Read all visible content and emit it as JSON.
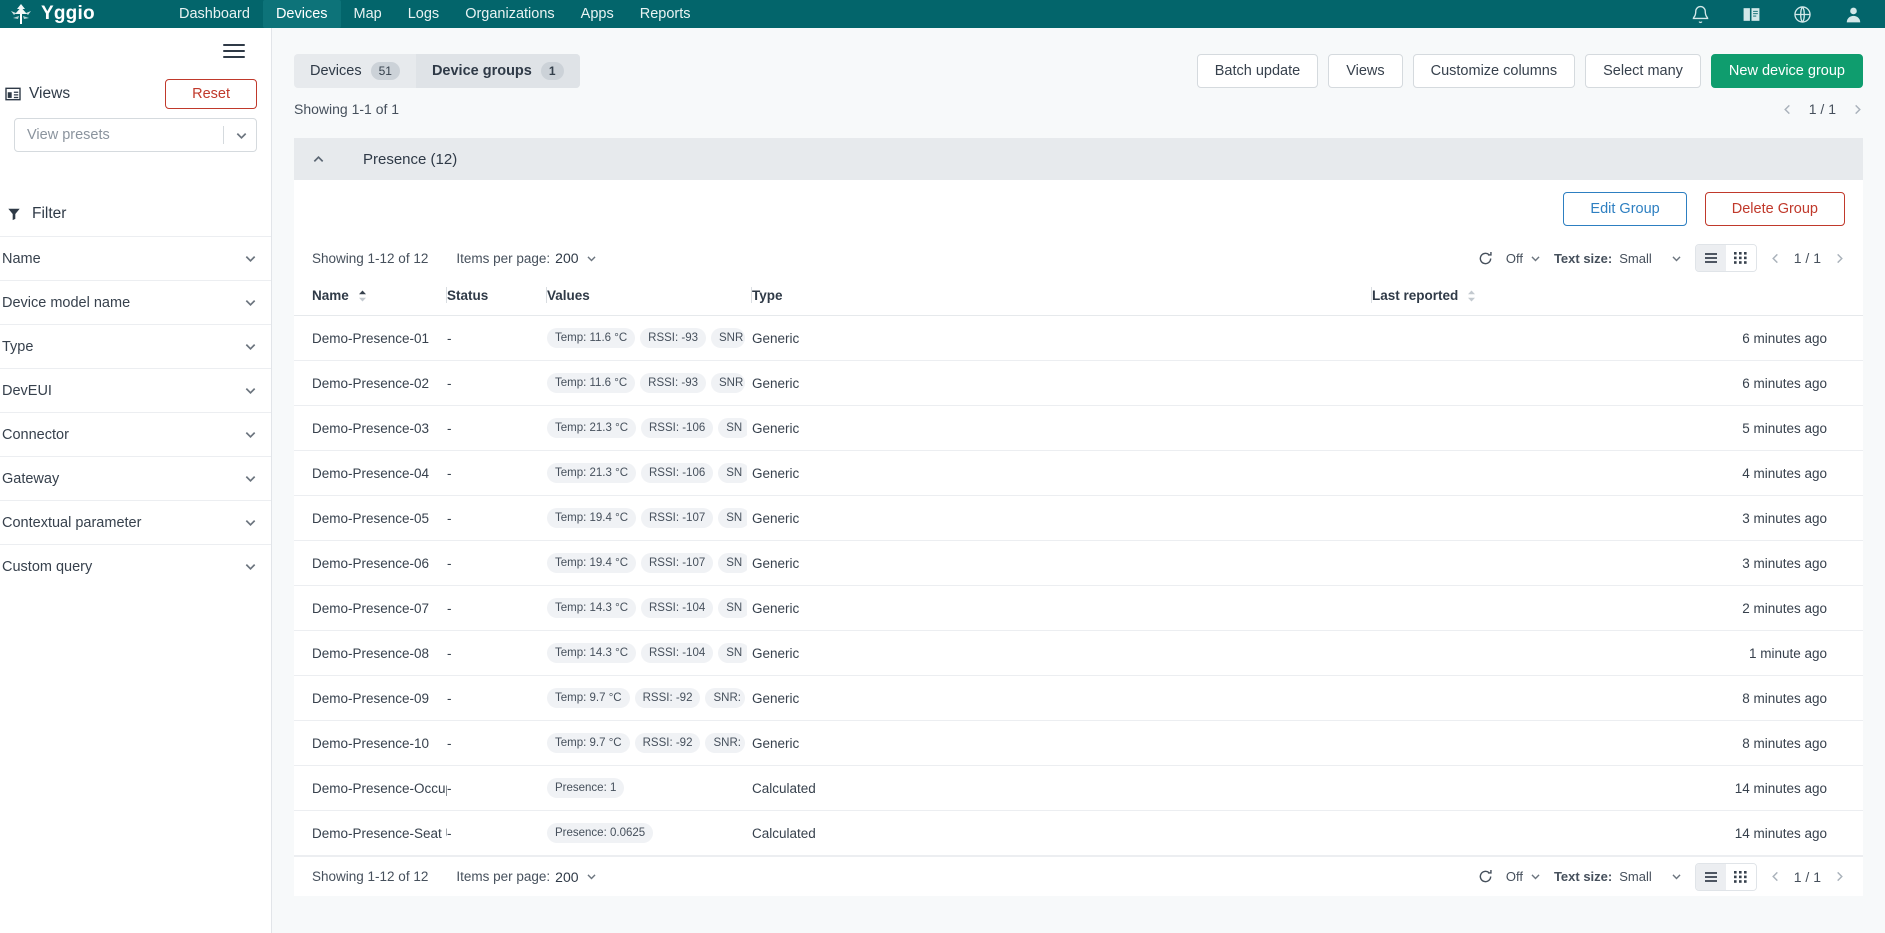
{
  "topnav": {
    "brand": "Yggio",
    "items": [
      {
        "label": "Dashboard",
        "active": false
      },
      {
        "label": "Devices",
        "active": true
      },
      {
        "label": "Map",
        "active": false
      },
      {
        "label": "Logs",
        "active": false
      },
      {
        "label": "Organizations",
        "active": false
      },
      {
        "label": "Apps",
        "active": false
      },
      {
        "label": "Reports",
        "active": false
      }
    ],
    "icons": [
      "bell-icon",
      "book-icon",
      "globe-icon",
      "account-icon"
    ],
    "background": "#03656b",
    "active_background": "#0d7379"
  },
  "sidebar": {
    "menu_icon": "hamburger-icon",
    "views": {
      "label": "Views",
      "icon": "layout-icon",
      "reset_label": "Reset",
      "reset_color": "#c0392b",
      "preset_placeholder": "View presets"
    },
    "filter": {
      "label": "Filter",
      "icon": "funnel-icon",
      "items": [
        {
          "label": "Name"
        },
        {
          "label": "Device model name"
        },
        {
          "label": "Type"
        },
        {
          "label": "DevEUI"
        },
        {
          "label": "Connector"
        },
        {
          "label": "Gateway"
        },
        {
          "label": "Contextual parameter"
        },
        {
          "label": "Custom query"
        }
      ]
    }
  },
  "main": {
    "tabs": [
      {
        "label": "Devices",
        "badge": "51",
        "active": false
      },
      {
        "label": "Device groups",
        "badge": "1",
        "active": true
      }
    ],
    "toolbar": [
      {
        "label": "Batch update",
        "style": "outline"
      },
      {
        "label": "Views",
        "style": "outline"
      },
      {
        "label": "Customize columns",
        "style": "outline"
      },
      {
        "label": "Select many",
        "style": "outline"
      },
      {
        "label": "New device group",
        "style": "primary"
      }
    ],
    "primary_color": "#0f9d6e",
    "showing": "Showing 1-1 of 1",
    "page_indicator": "1 / 1"
  },
  "group": {
    "title": "Presence (12)",
    "edit_label": "Edit Group",
    "delete_label": "Delete Group",
    "edit_color": "#2d7fc1",
    "delete_color": "#c0392b",
    "controls": {
      "showing": "Showing 1-12 of 12",
      "items_per_page_label": "Items per page:",
      "items_per_page_value": "200",
      "refresh_value": "Off",
      "text_size_label": "Text size:",
      "text_size_value": "Small",
      "page_indicator": "1 / 1",
      "view_list_icon": "list-view-icon",
      "view_grid_icon": "grid-view-icon"
    },
    "columns": [
      "Name",
      "Status",
      "Values",
      "Type",
      "",
      "Last reported"
    ],
    "rows": [
      {
        "name": "Demo-Presence-01",
        "status": "-",
        "values": [
          "Temp: 11.6 °C",
          "RSSI: -93",
          "SNR"
        ],
        "type": "Generic",
        "last": "6 minutes ago"
      },
      {
        "name": "Demo-Presence-02",
        "status": "-",
        "values": [
          "Temp: 11.6 °C",
          "RSSI: -93",
          "SNR"
        ],
        "type": "Generic",
        "last": "6 minutes ago"
      },
      {
        "name": "Demo-Presence-03",
        "status": "-",
        "values": [
          "Temp: 21.3 °C",
          "RSSI: -106",
          "SN"
        ],
        "type": "Generic",
        "last": "5 minutes ago"
      },
      {
        "name": "Demo-Presence-04",
        "status": "-",
        "values": [
          "Temp: 21.3 °C",
          "RSSI: -106",
          "SN"
        ],
        "type": "Generic",
        "last": "4 minutes ago"
      },
      {
        "name": "Demo-Presence-05",
        "status": "-",
        "values": [
          "Temp: 19.4 °C",
          "RSSI: -107",
          "SN"
        ],
        "type": "Generic",
        "last": "3 minutes ago"
      },
      {
        "name": "Demo-Presence-06",
        "status": "-",
        "values": [
          "Temp: 19.4 °C",
          "RSSI: -107",
          "SN"
        ],
        "type": "Generic",
        "last": "3 minutes ago"
      },
      {
        "name": "Demo-Presence-07",
        "status": "-",
        "values": [
          "Temp: 14.3 °C",
          "RSSI: -104",
          "SN"
        ],
        "type": "Generic",
        "last": "2 minutes ago"
      },
      {
        "name": "Demo-Presence-08",
        "status": "-",
        "values": [
          "Temp: 14.3 °C",
          "RSSI: -104",
          "SN"
        ],
        "type": "Generic",
        "last": "1 minute ago"
      },
      {
        "name": "Demo-Presence-09",
        "status": "-",
        "values": [
          "Temp: 9.7 °C",
          "RSSI: -92",
          "SNR:"
        ],
        "type": "Generic",
        "last": "8 minutes ago"
      },
      {
        "name": "Demo-Presence-10",
        "status": "-",
        "values": [
          "Temp: 9.7 °C",
          "RSSI: -92",
          "SNR:"
        ],
        "type": "Generic",
        "last": "8 minutes ago"
      },
      {
        "name": "Demo-Presence-Occup",
        "status": "-",
        "values": [
          "Presence: 1"
        ],
        "type": "Calculated",
        "last": "14 minutes ago"
      },
      {
        "name": "Demo-Presence-Seat U",
        "status": "-",
        "values": [
          "Presence: 0.0625"
        ],
        "type": "Calculated",
        "last": "14 minutes ago"
      }
    ]
  }
}
